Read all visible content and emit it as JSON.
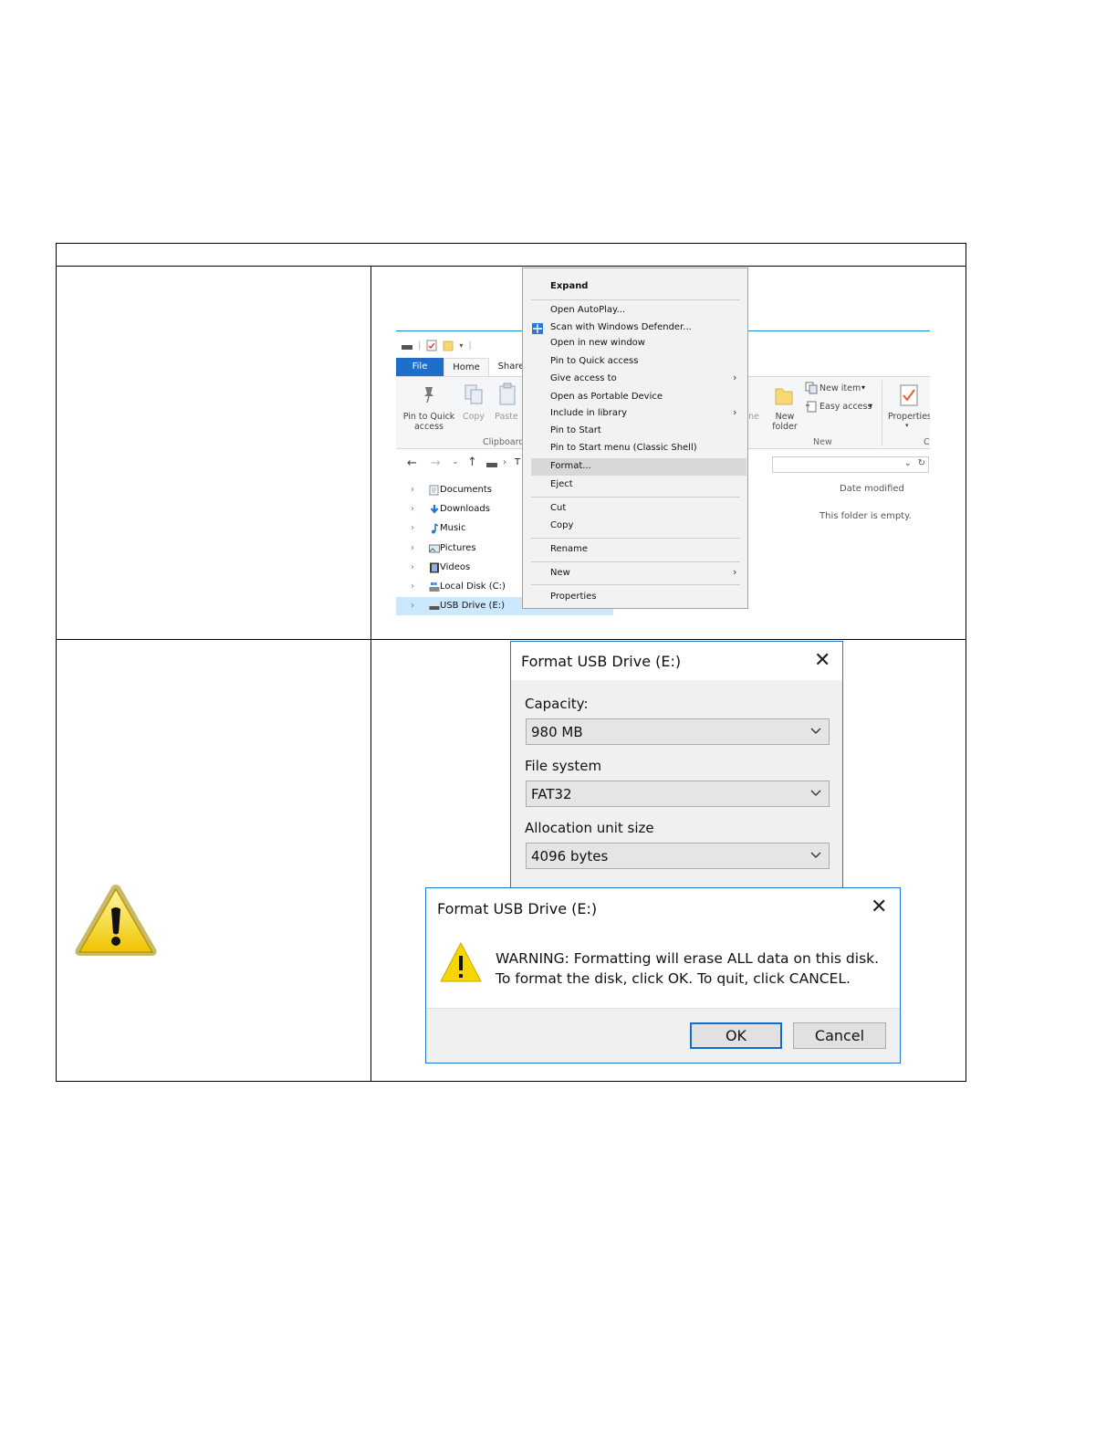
{
  "explorer": {
    "tabs": {
      "file": "File",
      "home": "Home",
      "share": "Share"
    },
    "ribbon": {
      "pin_quick_access": "Pin to Quick access",
      "copy": "Copy",
      "paste": "Paste",
      "clipboard_group": "Clipboard",
      "new_folder": "New folder",
      "new_item": "New item",
      "easy_access": "Easy access",
      "new_group": "New",
      "properties": "Properties"
    },
    "address_fragment": "T",
    "tree": [
      {
        "label": "Documents",
        "icon": "documents-icon"
      },
      {
        "label": "Downloads",
        "icon": "downloads-icon"
      },
      {
        "label": "Music",
        "icon": "music-icon"
      },
      {
        "label": "Pictures",
        "icon": "pictures-icon"
      },
      {
        "label": "Videos",
        "icon": "videos-icon"
      },
      {
        "label": "Local Disk (C:)",
        "icon": "local-disk-icon"
      },
      {
        "label": "USB Drive (E:)",
        "icon": "usb-drive-icon"
      }
    ],
    "column_date_modified": "Date modified",
    "empty_message": "This folder is empty."
  },
  "context_menu": {
    "items": [
      "Expand",
      "Open AutoPlay...",
      "Scan with Windows Defender...",
      "Open in new window",
      "Pin to Quick access",
      "Give access to",
      "Open as Portable Device",
      "Include in library",
      "Pin to Start",
      "Pin to Start menu (Classic Shell)",
      "Format...",
      "Eject",
      "Cut",
      "Copy",
      "Rename",
      "New",
      "Properties"
    ],
    "highlighted": "Format..."
  },
  "format_dialog": {
    "title": "Format USB Drive (E:)",
    "capacity_label": "Capacity:",
    "capacity_value": "980 MB",
    "filesystem_label": "File system",
    "filesystem_value": "FAT32",
    "alloc_label": "Allocation unit size",
    "alloc_value": "4096 bytes"
  },
  "warning_dialog": {
    "title": "Format USB Drive (E:)",
    "line1": "WARNING: Formatting will erase ALL data on this disk.",
    "line2": "To format the disk, click OK. To quit, click CANCEL.",
    "ok": "OK",
    "cancel": "Cancel"
  },
  "colors": {
    "accent_blue": "#1e6fc9",
    "warning_yellow": "#f7d600",
    "selection": "#cce8ff"
  }
}
